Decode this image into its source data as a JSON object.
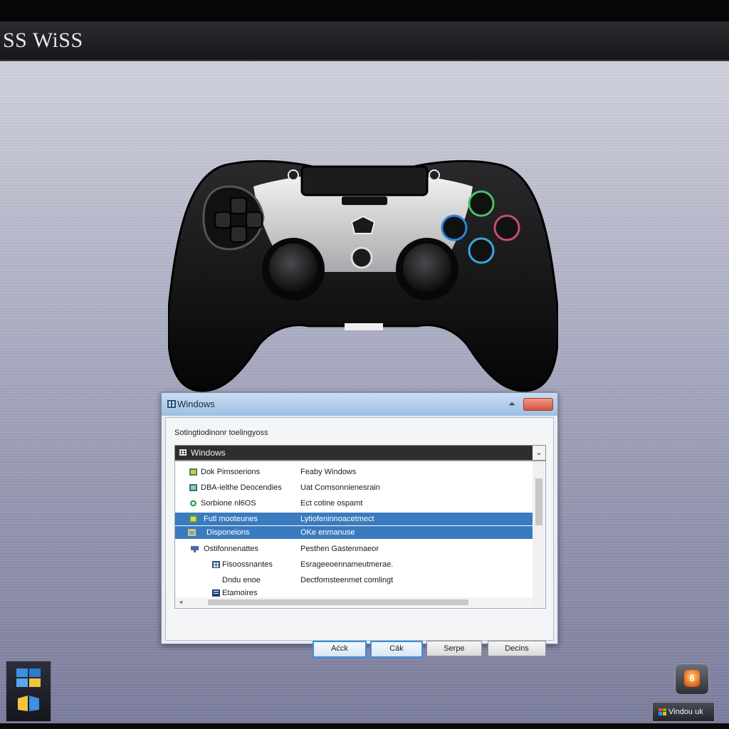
{
  "app": {
    "title": "SS WiSS"
  },
  "dialog": {
    "title": "Windows",
    "caption": "Sotingtiodinonr toelingyoss",
    "combo_value": "Windows",
    "rows": [
      {
        "icon": "program-icon",
        "name": "Dok Pimsoerions",
        "value": "Feaby Windows",
        "selected": false
      },
      {
        "icon": "program-icon",
        "name": "DBA-ielthe Deocendies",
        "value": "Uat Comsonnienesrain",
        "selected": false
      },
      {
        "icon": "program-icon",
        "name": "Sorbione nl6OS",
        "value": "Ect cotine ospamt",
        "selected": false
      },
      {
        "icon": "program-icon",
        "name": "Futl mooteunes",
        "value": "Lytiofeninnoacetmect",
        "selected": true
      },
      {
        "icon": "folder-icon",
        "name": "Disponeions",
        "value": "OKe enmanuse",
        "selected": true
      },
      {
        "icon": "monitor-icon",
        "name": "Ostifonnenattes",
        "value": "Pesthen Gastenmaeor",
        "selected": false
      },
      {
        "icon": "grid-icon",
        "name": "Fisoossnantes",
        "value": "Esrageeoennameutmerae.",
        "selected": false
      },
      {
        "icon": "",
        "name": "Dndu enoe",
        "value": "Dectfomsteenmet comlingt",
        "selected": false
      },
      {
        "icon": "doc-icon",
        "name": "Etamoires",
        "value": "",
        "selected": false
      }
    ],
    "buttons": {
      "ack": "Aćck",
      "ok": "Cák",
      "serpe": "Serpe",
      "decins": "Decins"
    }
  },
  "taskbar": {
    "tray_label": "Vindou uk",
    "tray_app_glyph": "6"
  },
  "colors": {
    "selection": "#3a7bbf",
    "title_gradient_top": "#c9dcf2",
    "close": "#d4533e",
    "accent_button": "#3e8fd6"
  }
}
